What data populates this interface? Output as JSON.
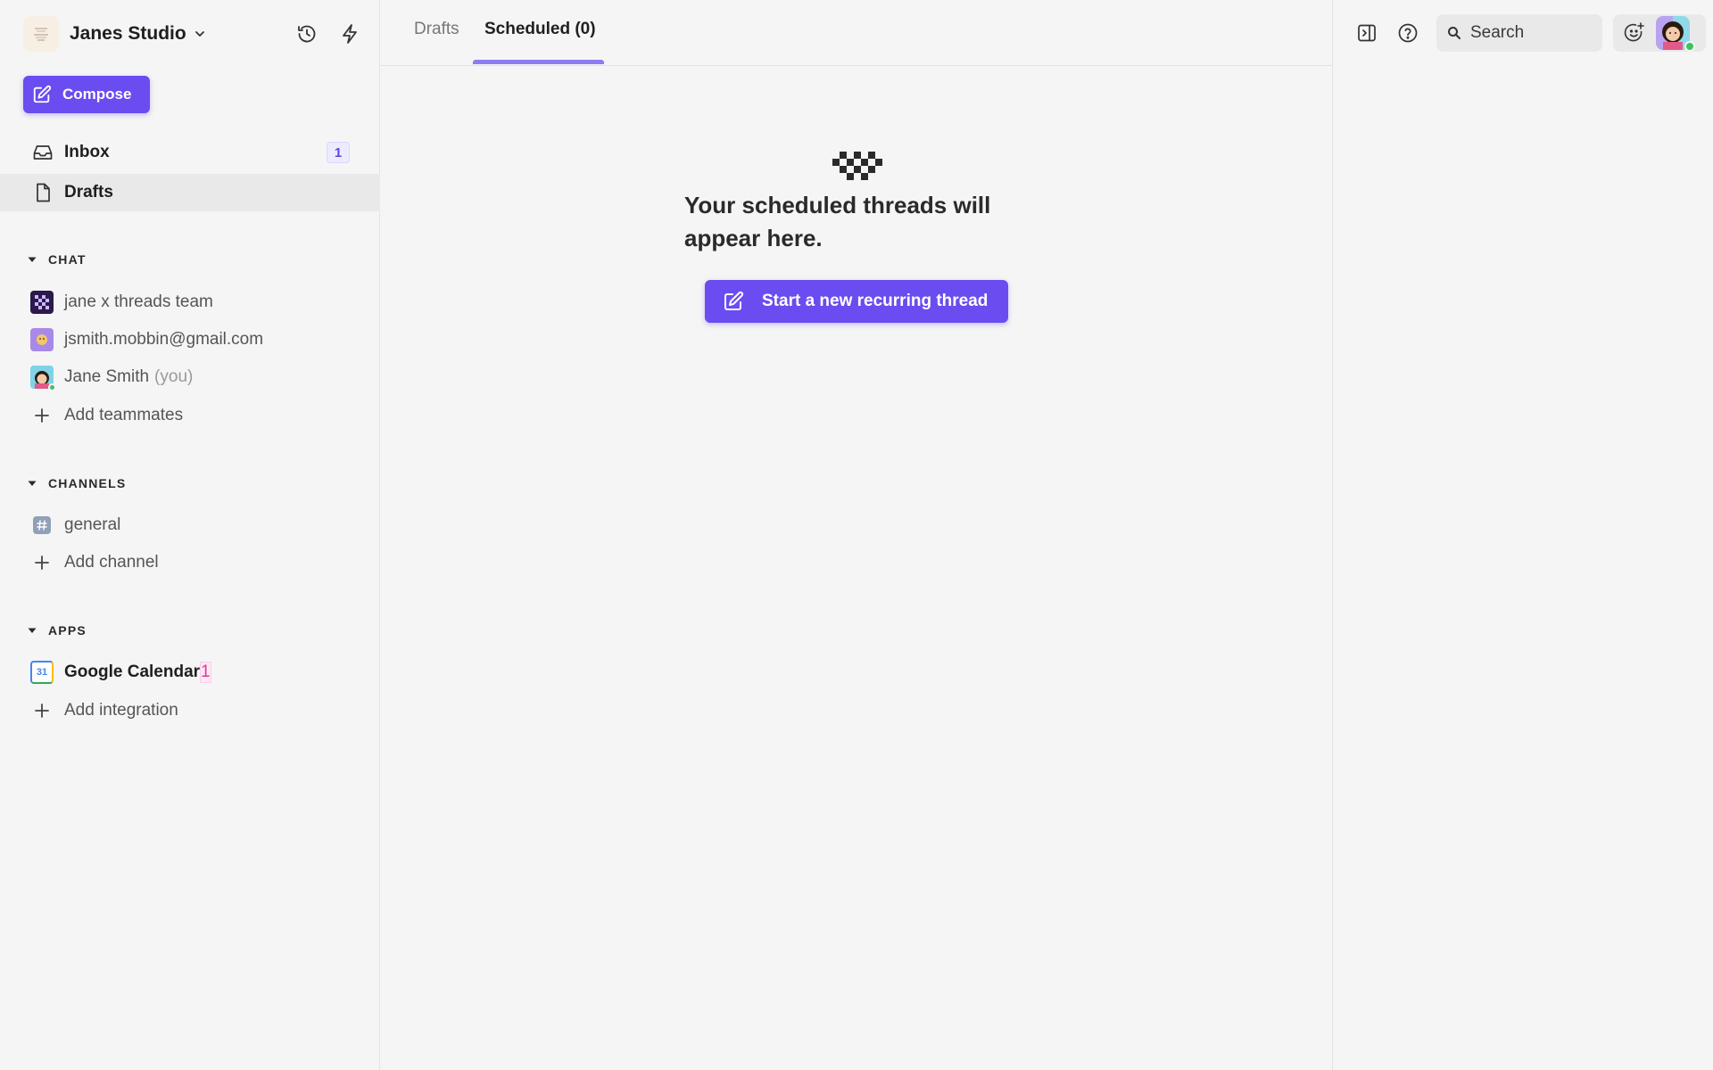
{
  "workspace": {
    "name": "Janes Studio"
  },
  "sidebar": {
    "compose_label": "Compose",
    "nav": [
      {
        "label": "Inbox",
        "badge": "1",
        "icon": "inbox-icon"
      },
      {
        "label": "Drafts",
        "icon": "document-icon",
        "active": true
      }
    ],
    "chat": {
      "title": "CHAT",
      "items": [
        {
          "label": "jane x threads team",
          "icon": "team-avatar"
        },
        {
          "label": "jsmith.mobbin@gmail.com",
          "icon": "user-avatar"
        },
        {
          "label": "Jane Smith",
          "suffix": "(you)",
          "icon": "self-avatar"
        }
      ],
      "add_label": "Add teammates"
    },
    "channels": {
      "title": "CHANNELS",
      "items": [
        {
          "label": "general",
          "icon": "hash-icon"
        }
      ],
      "add_label": "Add channel"
    },
    "apps": {
      "title": "APPS",
      "items": [
        {
          "label": "Google Calendar",
          "badge": "1",
          "icon": "calendar-icon",
          "calendar_day": "31"
        }
      ],
      "add_label": "Add integration"
    }
  },
  "main": {
    "tabs": [
      {
        "label": "Drafts",
        "active": false
      },
      {
        "label": "Scheduled (0)",
        "active": true
      }
    ],
    "empty_title": "Your scheduled threads will appear here.",
    "cta_label": "Start a new recurring thread"
  },
  "right": {
    "search_placeholder": "Search"
  },
  "colors": {
    "accent": "#6a4cf0",
    "tab_underline": "#8b7cf2",
    "online": "#3cc35b",
    "badge_blue": "#5b48e0",
    "badge_pink": "#d93b96"
  }
}
